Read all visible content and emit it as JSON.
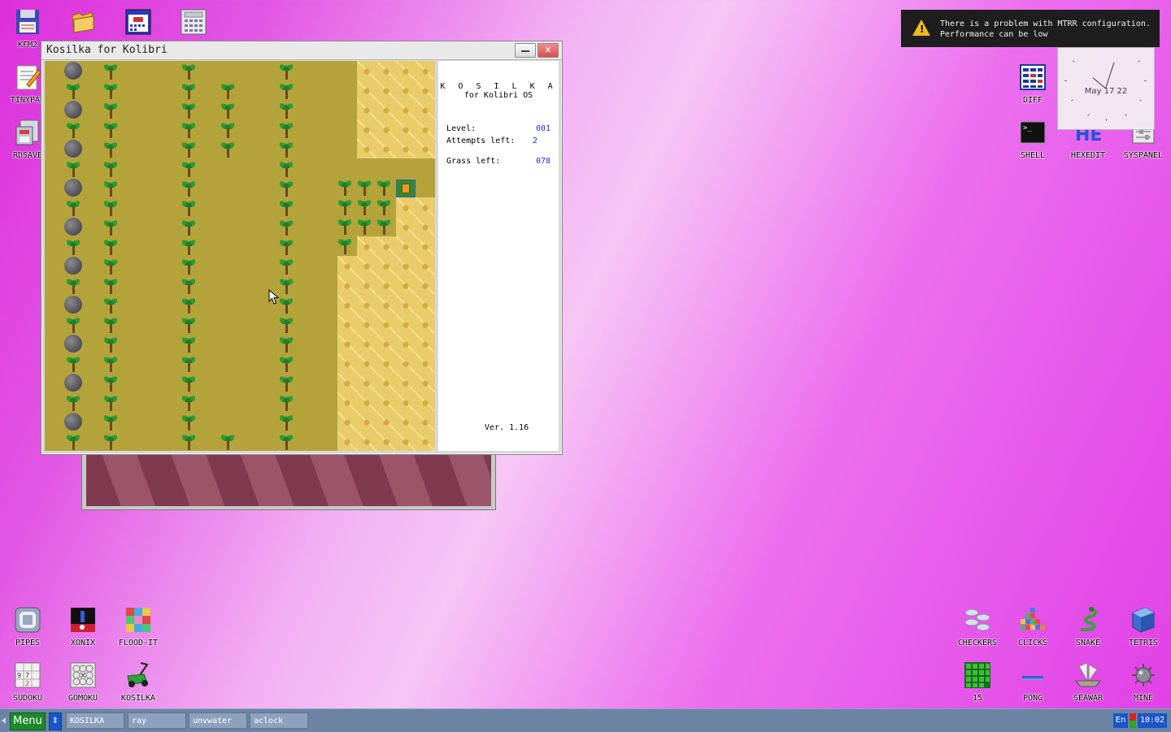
{
  "notification": {
    "line1": "There is a problem with MTRR configuration.",
    "line2": "Performance can be low"
  },
  "clock": {
    "date": "May 17 22"
  },
  "window": {
    "title": "Kosilka for Kolibri",
    "close_label": "×"
  },
  "game": {
    "heading": "K O S I L K A",
    "subheading": "for Kolibri OS",
    "level_label": "Level:",
    "level_value": "001",
    "attempts_label": "Attempts left:",
    "attempts_value": "2",
    "grass_label": "Grass left:",
    "grass_value": "078",
    "version": "Ver. 1.16"
  },
  "desktop_icons": {
    "kfm2": "KFM2",
    "tinypad": "TINYPAD",
    "rdsave": "RDSAVE",
    "diff": "DIFF",
    "shell": "SHELL",
    "hexedit": "HEXEDIT",
    "syspanel": "SYSPANEL",
    "pipes": "PIPES",
    "xonix": "XONIX",
    "floodit": "FLOOD-IT",
    "sudoku": "SUDOKU",
    "gomoku": "GOMOKU",
    "kosilka": "KOSILKA",
    "checkers": "CHECKERS",
    "clicks": "CLICKS",
    "snake": "SNAKE",
    "tetris": "TETRIS",
    "fifteen": "15",
    "pong": "PONG",
    "seawar": "SEAWAR",
    "mine": "MINE"
  },
  "taskbar": {
    "menu": "Menu",
    "switch": "⇕",
    "tasks": [
      "KOSILKA",
      "ray",
      "unvwater",
      "aclock"
    ],
    "lang": "En",
    "time": "10:02"
  }
}
